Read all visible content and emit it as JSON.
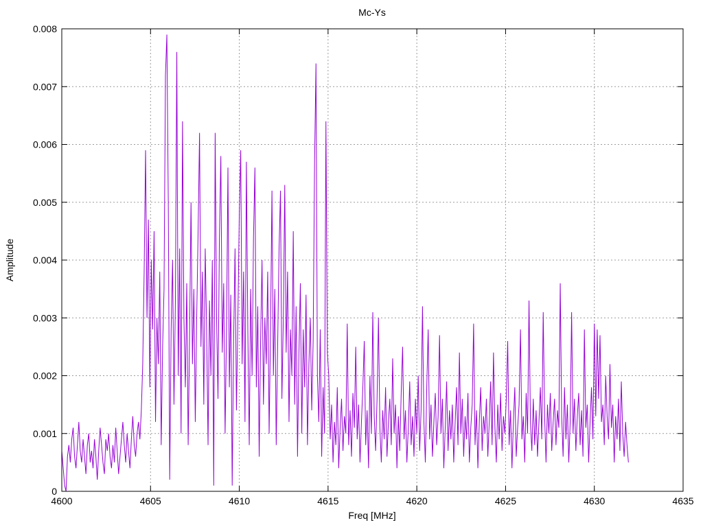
{
  "chart_data": {
    "type": "line",
    "title": "Mc-Ys",
    "xlabel": "Freq [MHz]",
    "ylabel": "Amplitude",
    "xlim": [
      4600,
      4635
    ],
    "ylim": [
      0,
      0.008
    ],
    "x_ticks": [
      4600,
      4605,
      4610,
      4615,
      4620,
      4625,
      4630,
      4635
    ],
    "x_tick_labels": [
      "4600",
      "4605",
      "4610",
      "4615",
      "4620",
      "4625",
      "4630",
      "4635"
    ],
    "y_ticks": [
      0,
      0.001,
      0.002,
      0.003,
      0.004,
      0.005,
      0.006,
      0.007,
      0.008
    ],
    "y_tick_labels": [
      "0",
      "0.001",
      "0.002",
      "0.003",
      "0.004",
      "0.005",
      "0.006",
      "0.007",
      "0.008"
    ],
    "grid": true,
    "legend": "none",
    "line_color": "#9400d3",
    "grid_color": "#9a9a9a",
    "axis_color": "#000000",
    "series": [
      {
        "name": "Mc-Ys",
        "x_start": 4600.0,
        "x_step": 0.08,
        "y_scale": 0.0001,
        "y_values": [
          7,
          4,
          1,
          0,
          6,
          8,
          5,
          9,
          11,
          6,
          4,
          8,
          12,
          7,
          5,
          9,
          6,
          3,
          8,
          10,
          5,
          7,
          4,
          9,
          6,
          2,
          7,
          11,
          8,
          5,
          3,
          9,
          7,
          10,
          6,
          4,
          8,
          5,
          11,
          7,
          3,
          6,
          9,
          12,
          8,
          5,
          10,
          7,
          4,
          9,
          13,
          8,
          6,
          10,
          12,
          9,
          14,
          22,
          38,
          59,
          30,
          47,
          18,
          40,
          28,
          45,
          12,
          30,
          22,
          38,
          8,
          25,
          35,
          72,
          79,
          50,
          2,
          28,
          40,
          15,
          33,
          76,
          20,
          42,
          10,
          64,
          30,
          18,
          36,
          8,
          27,
          50,
          22,
          35,
          12,
          30,
          45,
          62,
          25,
          38,
          15,
          42,
          28,
          8,
          33,
          20,
          40,
          1,
          62,
          30,
          16,
          44,
          58,
          24,
          36,
          10,
          28,
          56,
          18,
          34,
          1,
          26,
          42,
          14,
          30,
          48,
          59,
          22,
          38,
          12,
          57,
          28,
          8,
          35,
          20,
          44,
          56,
          18,
          32,
          6,
          26,
          40,
          15,
          30,
          22,
          38,
          10,
          28,
          52,
          20,
          35,
          8,
          25,
          42,
          52,
          16,
          30,
          53,
          24,
          38,
          12,
          28,
          20,
          45,
          15,
          32,
          6,
          24,
          36,
          10,
          28,
          18,
          34,
          8,
          22,
          30,
          14,
          26,
          57,
          74,
          20,
          12,
          28,
          6,
          18,
          10,
          64,
          24,
          20,
          9,
          15,
          5,
          12,
          8,
          18,
          4,
          11,
          16,
          7,
          13,
          10,
          29,
          8,
          14,
          6,
          17,
          11,
          25,
          9,
          15,
          5,
          12,
          18,
          26,
          8,
          14,
          4,
          20,
          10,
          31,
          13,
          7,
          16,
          30,
          11,
          5,
          14,
          9,
          18,
          6,
          12,
          16,
          8,
          23,
          10,
          15,
          4,
          13,
          7,
          17,
          25,
          9,
          14,
          5,
          11,
          19,
          8,
          13,
          6,
          16,
          10,
          20,
          7,
          14,
          32,
          12,
          5,
          18,
          28,
          9,
          15,
          6,
          12,
          17,
          8,
          13,
          27,
          10,
          16,
          4,
          11,
          19,
          7,
          14,
          9,
          15,
          5,
          12,
          18,
          8,
          24,
          10,
          16,
          6,
          13,
          9,
          17,
          5,
          11,
          15,
          29,
          8,
          14,
          4,
          12,
          18,
          7,
          13,
          10,
          16,
          6,
          12,
          19,
          8,
          24,
          11,
          5,
          15,
          9,
          17,
          7,
          13,
          10,
          16,
          26,
          8,
          14,
          4,
          12,
          18,
          6,
          11,
          15,
          28,
          9,
          13,
          5,
          17,
          10,
          33,
          12,
          7,
          16,
          8,
          14,
          6,
          12,
          18,
          9,
          31,
          13,
          5,
          15,
          10,
          17,
          7,
          12,
          16,
          8,
          14,
          11,
          36,
          13,
          6,
          18,
          9,
          15,
          5,
          12,
          31,
          10,
          16,
          7,
          13,
          17,
          8,
          14,
          6,
          28,
          11,
          15,
          5,
          12,
          18,
          9,
          29,
          13,
          28,
          16,
          27,
          12,
          15,
          8,
          20,
          13,
          9,
          22,
          11,
          15,
          5,
          13,
          9,
          16,
          7,
          19,
          10,
          6,
          12,
          8,
          5
        ]
      }
    ]
  }
}
